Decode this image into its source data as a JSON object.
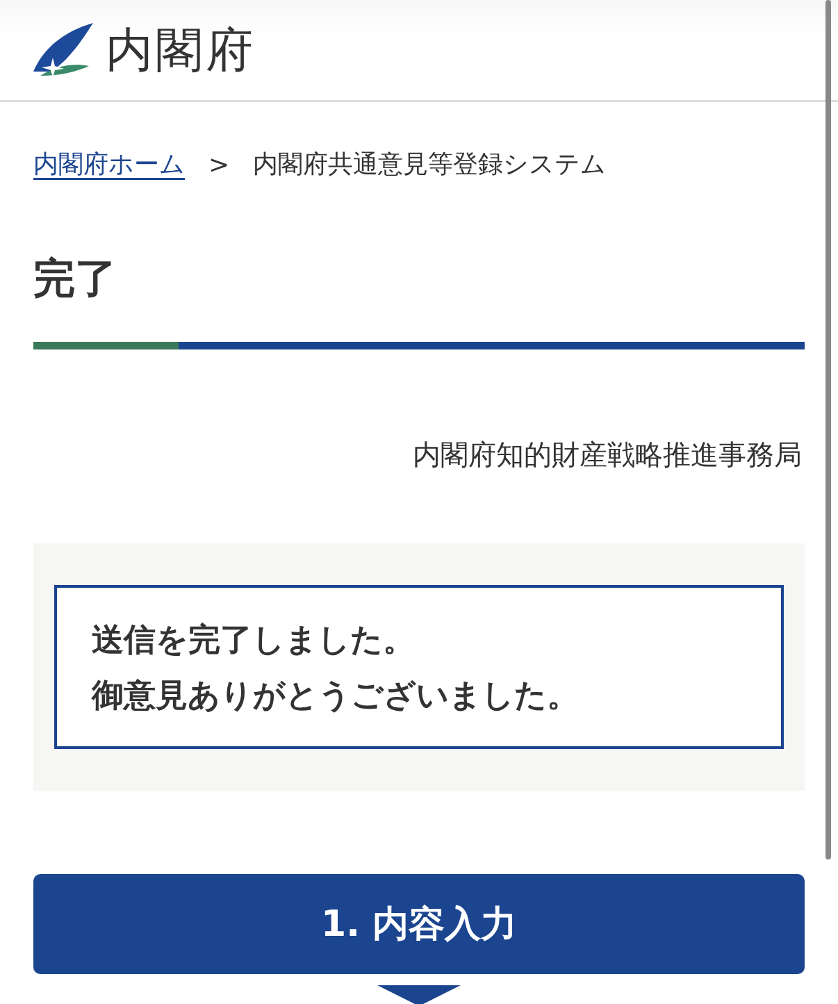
{
  "header": {
    "title": "内閣府"
  },
  "breadcrumb": [
    {
      "label": "内閣府ホーム",
      "kind": "link"
    },
    {
      "label": ">",
      "kind": "separator"
    },
    {
      "label": "内閣府共通意見等登録システム",
      "kind": "current"
    }
  ],
  "heading": "完了",
  "organization": "内閣府知的財産戦略推進事務局",
  "message": [
    "送信を完了しました。",
    "御意見ありがとうございました。"
  ],
  "step": {
    "label": "1. 内容入力"
  }
}
